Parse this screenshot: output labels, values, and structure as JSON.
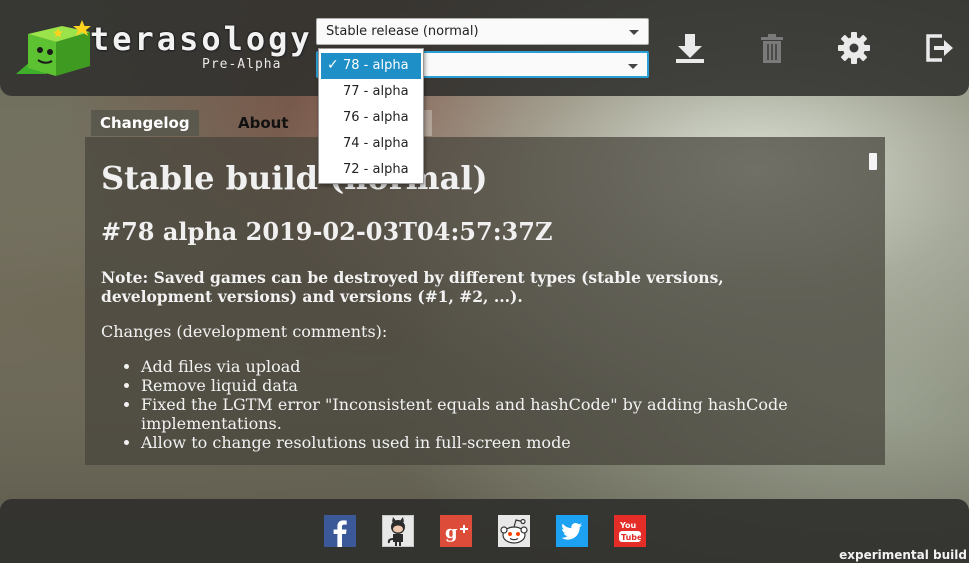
{
  "app": {
    "logo_title": "terasology",
    "logo_subtitle": "Pre-Alpha"
  },
  "header": {
    "job_select_value": "Stable release (normal)",
    "version_select_value": "",
    "version_options": [
      "78 - alpha",
      "77 - alpha",
      "76 - alpha",
      "74 - alpha",
      "72 - alpha"
    ],
    "selected_version": "78 - alpha",
    "check_mark": "✓",
    "icons": [
      "download-icon",
      "delete-icon",
      "settings-icon",
      "logout-icon"
    ]
  },
  "tabs": [
    {
      "label": "Changelog",
      "active": true
    },
    {
      "label": "About",
      "active": false
    },
    {
      "label": "",
      "active": false
    }
  ],
  "changelog": {
    "title": "Stable build (normal)",
    "version_heading": "#78 alpha 2019-02-03T04:57:37Z",
    "note": "Note: Saved games can be destroyed by different types (stable versions, development versions) and versions (#1, #2, ...).",
    "changes_label": "Changes (development comments):",
    "changes": [
      "Add files via upload",
      "Remove liquid data",
      "Fixed the LGTM error \"Inconsistent equals and hashCode\" by adding hashCode implementations.",
      "Allow to change resolutions used in full-screen mode"
    ]
  },
  "footer": {
    "social_icons": [
      "facebook-icon",
      "github-icon",
      "google-plus-icon",
      "reddit-icon",
      "twitter-icon",
      "youtube-icon"
    ],
    "build_label": "experimental build"
  },
  "colors": {
    "accent": "#1f8fc8",
    "select_focus": "#2a9fd6",
    "facebook": "#3b5998",
    "google_plus": "#dd4b39",
    "twitter": "#1da1f2",
    "youtube": "#e52d27"
  }
}
